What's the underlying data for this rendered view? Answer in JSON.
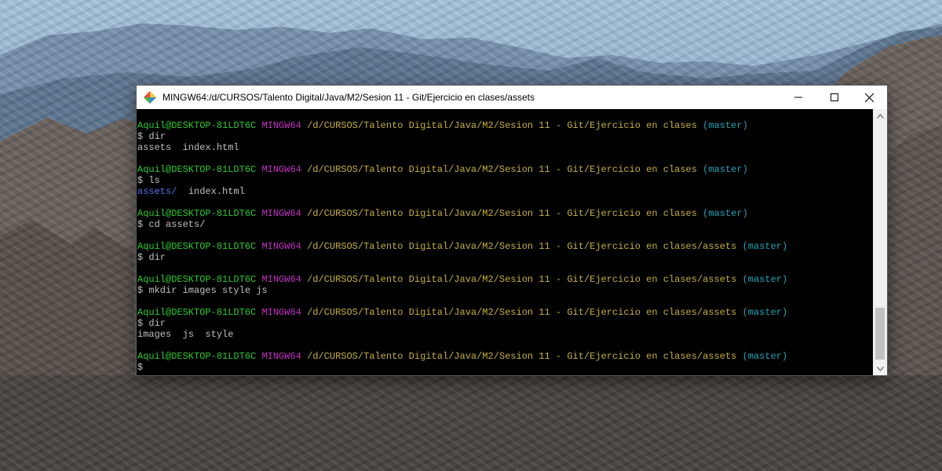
{
  "window": {
    "title": "MINGW64:/d/CURSOS/Talento Digital/Java/M2/Sesion 11 - Git/Ejercicio en clases/assets",
    "icons": {
      "app": "git-bash-icon",
      "minimize": "minimize-icon",
      "maximize": "maximize-icon",
      "close": "close-icon"
    }
  },
  "terminal": {
    "user_host": "Aquil@DESKTOP-81LDT6C",
    "shell": "MINGW64",
    "branch": "(master)",
    "prompt_symbol": "$",
    "path_clases": "/d/CURSOS/Talento Digital/Java/M2/Sesion 11 - Git/Ejercicio en clases",
    "path_assets": "/d/CURSOS/Talento Digital/Java/M2/Sesion 11 - Git/Ejercicio en clases/assets",
    "entries": [
      {
        "path": "path_clases",
        "command": "dir",
        "output": "assets  index.html"
      },
      {
        "path": "path_clases",
        "command": "ls",
        "output_dir": "assets/",
        "output_rest": "  index.html"
      },
      {
        "path": "path_clases",
        "command": "cd assets/"
      },
      {
        "path": "path_assets",
        "command": "dir"
      },
      {
        "path": "path_assets",
        "command": "mkdir images style js"
      },
      {
        "path": "path_assets",
        "command": "dir",
        "output": "images  js  style"
      },
      {
        "path": "path_assets",
        "command": ""
      }
    ],
    "colors": {
      "user": "#2ec92e",
      "shell": "#c231c2",
      "path": "#c5b13c",
      "branch": "#1fa6b8",
      "dir": "#5b6cf0"
    }
  },
  "scrollbar": {
    "up_icon": "scroll-up-arrow-icon",
    "down_icon": "scroll-down-arrow-icon"
  }
}
